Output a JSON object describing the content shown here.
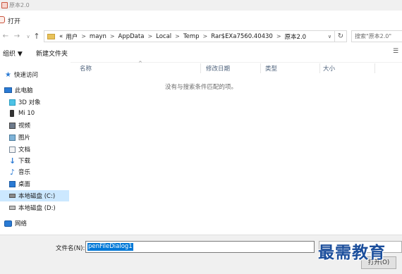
{
  "background_window": {
    "title": "原本2.0"
  },
  "dialog": {
    "title": "打开"
  },
  "address": {
    "segments": [
      "«",
      "用户",
      "mayn",
      "AppData",
      "Local",
      "Temp",
      "Rar$EXa7560.40430",
      "原本2.0"
    ]
  },
  "search": {
    "placeholder": "搜索\"原本2.0\""
  },
  "toolbar": {
    "organize_label": "组织 ▼",
    "new_folder_label": "新建文件夹"
  },
  "sidebar": {
    "items": [
      {
        "label": "快速访问",
        "icon": "star-icon"
      },
      {
        "label": "此电脑",
        "icon": "computer-icon"
      },
      {
        "label": "3D 对象",
        "icon": "cube-icon"
      },
      {
        "label": "Mi 10",
        "icon": "phone-icon"
      },
      {
        "label": "视频",
        "icon": "video-icon"
      },
      {
        "label": "图片",
        "icon": "picture-icon"
      },
      {
        "label": "文档",
        "icon": "document-icon"
      },
      {
        "label": "下载",
        "icon": "download-icon"
      },
      {
        "label": "音乐",
        "icon": "music-icon"
      },
      {
        "label": "桌面",
        "icon": "desktop-icon"
      },
      {
        "label": "本地磁盘 (C:)",
        "icon": "drive-icon"
      },
      {
        "label": "本地磁盘 (D:)",
        "icon": "drive-icon"
      },
      {
        "label": "网络",
        "icon": "network-icon"
      }
    ],
    "selected_index": 10
  },
  "columns": [
    "名称",
    "修改日期",
    "类型",
    "大小"
  ],
  "empty_message": "没有与搜索条件匹配的项。",
  "filename": {
    "label": "文件名(N):",
    "value": "penFileDialog1"
  },
  "filetype": {
    "value": ""
  },
  "open_button": {
    "label": "打开(O)"
  },
  "watermark": {
    "text": "最需教育"
  },
  "colors": {
    "accent": "#0078d7",
    "selection": "#cce8ff",
    "watermark": "#1c4f9c"
  }
}
